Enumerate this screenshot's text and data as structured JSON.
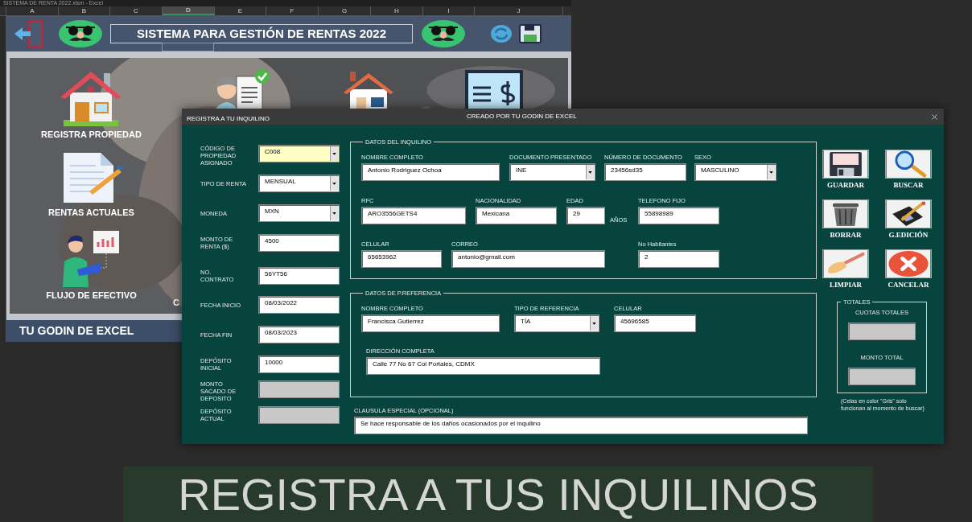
{
  "excel": {
    "title": "SISTEMA DE RENTA 2022.xlsm - Excel",
    "columns": [
      {
        "label": "A",
        "selected": false
      },
      {
        "label": "B",
        "selected": false
      },
      {
        "label": "C",
        "selected": false
      },
      {
        "label": "D",
        "selected": true
      },
      {
        "label": "E",
        "selected": false
      },
      {
        "label": "F",
        "selected": false
      },
      {
        "label": "G",
        "selected": false
      },
      {
        "label": "H",
        "selected": false
      },
      {
        "label": "I",
        "selected": false
      },
      {
        "label": "J",
        "selected": false
      }
    ],
    "banner_title": "SISTEMA PARA GESTIÓN DE RENTAS 2022",
    "menu": [
      {
        "label": "REGISTRA PROPIEDAD"
      },
      {
        "label": "RENTAS ACTUALES"
      },
      {
        "label": "FLUJO DE EFECTIVO"
      },
      {
        "label": "C"
      }
    ],
    "footer": "TU GODIN DE EXCEL"
  },
  "dialog": {
    "title": "REGISTRA A TU INQUILINO",
    "subtitle": "CREADO POR TU GODIN DE EXCEL",
    "property_fields": [
      {
        "label": "CÓDIGO DE\nPROPIEDAD\nASIGNADO",
        "value": "C008",
        "kind": "combo",
        "highlighted": true,
        "disabled": false
      },
      {
        "label": "TIPO DE RENTA",
        "value": "MENSUAL",
        "kind": "combo",
        "highlighted": false,
        "disabled": false
      },
      {
        "label": "MONEDA",
        "value": "MXN",
        "kind": "combo",
        "highlighted": false,
        "disabled": false
      },
      {
        "label": "MONTO DE\nRENTA ($)",
        "value": "4500",
        "kind": "text",
        "highlighted": false,
        "disabled": false
      },
      {
        "label": "NO.\nCONTRATO",
        "value": "56YT56",
        "kind": "text",
        "highlighted": false,
        "disabled": false
      },
      {
        "label": "FECHA INICIO",
        "value": "08/03/2022",
        "kind": "text",
        "highlighted": false,
        "disabled": false
      },
      {
        "label": "FECHA FIN",
        "value": "08/03/2023",
        "kind": "text",
        "highlighted": false,
        "disabled": false
      },
      {
        "label": "DEPÓSITO\nINICIAL",
        "value": "10000",
        "kind": "text",
        "highlighted": false,
        "disabled": false
      },
      {
        "label": "MONTO\nSACADO DE\nDEPOSITO",
        "kind": "text",
        "highlighted": false,
        "disabled": true
      },
      {
        "label": "DEPÓSITO\nACTUAL",
        "kind": "text",
        "highlighted": false,
        "disabled": true
      }
    ],
    "tenant_group": {
      "title": "DATOS DEL INQUILINO",
      "fields": [
        {
          "label": "NOMBRE COMPLETO",
          "value": "Antonio Rodriguez Ochoa",
          "kind": "text"
        },
        {
          "label": "DOCUMENTO PRESENTADO",
          "value": "INE",
          "kind": "combo"
        },
        {
          "label": "NÚMERO DE DOCUMENTO",
          "value": "23456sd35",
          "kind": "text"
        },
        {
          "label": "SEXO",
          "value": "MASCULINO",
          "kind": "combo"
        },
        {
          "label": "RFC",
          "value": "ARO3556GETS4",
          "kind": "text"
        },
        {
          "label": "NACIONALIDAD",
          "value": "Mexicana",
          "kind": "text"
        },
        {
          "label": "EDAD",
          "value": "29",
          "kind": "text",
          "suffix": "AÑOS"
        },
        {
          "label": "TELEFONO FIJO",
          "value": "55898989",
          "kind": "text"
        },
        {
          "label": "CELULAR",
          "value": "65653962",
          "kind": "text"
        },
        {
          "label": "CORREO",
          "value": "antonio@gmail.com",
          "kind": "text"
        },
        {
          "label": "No Habitantes",
          "value": "2",
          "kind": "text"
        }
      ]
    },
    "reference_group": {
      "title": "DATOS DE P.REFERENCIA",
      "fields": [
        {
          "label": "NOMBRE COMPLETO",
          "value": "Francisca Gutierrez",
          "kind": "text"
        },
        {
          "label": "TIPO DE REFERENCIA",
          "value": "TÍA",
          "kind": "combo"
        },
        {
          "label": "CELULAR",
          "value": "45696585",
          "kind": "text"
        },
        {
          "label": "DIRECCIÓN COMPLETA",
          "value": "Calle 77 No 67 Col Portales, CDMX",
          "kind": "text"
        }
      ]
    },
    "special_clause": {
      "label": "CLAUSULA ESPECIAL (OPCIONAL)",
      "value": "Se hace responsable de los daños ocasionados por el inquilino"
    },
    "actions": [
      {
        "label": "GUARDAR",
        "kind": "save"
      },
      {
        "label": "BUSCAR",
        "kind": "search"
      },
      {
        "label": "BORRAR",
        "kind": "delete"
      },
      {
        "label": "G.EDICIÓN",
        "kind": "edit"
      },
      {
        "label": "LIMPIAR",
        "kind": "clear"
      },
      {
        "label": "CANCELAR",
        "kind": "cancel"
      }
    ],
    "totals": {
      "title": "TOTALES",
      "fields": [
        {
          "label": "CUOTAS TOTALES",
          "disabled": true
        },
        {
          "label": "MONTO TOTAL",
          "disabled": true
        }
      ]
    },
    "note": "(Celas en color \"Gris\" solo funcionan al momento de buscar)"
  },
  "caption": "REGISTRA A TUS INQUILINOS"
}
